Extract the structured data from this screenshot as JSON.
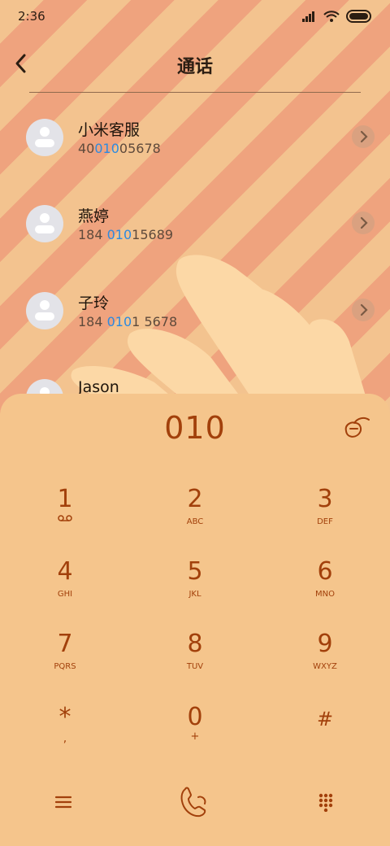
{
  "status_bar": {
    "time": "2:36"
  },
  "header": {
    "title": "通话"
  },
  "contacts": [
    {
      "name": "小米客服",
      "number_pre": "40",
      "number_hl": "010",
      "number_post": "05678"
    },
    {
      "name": "燕婷",
      "number_pre": "184 ",
      "number_hl": "010",
      "number_post": "15689"
    },
    {
      "name": "子玲",
      "number_pre": "184 ",
      "number_hl": "010",
      "number_post": "1 5678"
    },
    {
      "name": "Jason",
      "number_pre": "",
      "number_hl": "",
      "number_post": ""
    }
  ],
  "dialer": {
    "dialed": "010",
    "keys": [
      {
        "num": "1",
        "sub": ""
      },
      {
        "num": "2",
        "sub": "ABC"
      },
      {
        "num": "3",
        "sub": "DEF"
      },
      {
        "num": "4",
        "sub": "GHI"
      },
      {
        "num": "5",
        "sub": "JKL"
      },
      {
        "num": "6",
        "sub": "MNO"
      },
      {
        "num": "7",
        "sub": "PQRS"
      },
      {
        "num": "8",
        "sub": "TUV"
      },
      {
        "num": "9",
        "sub": "WXYZ"
      },
      {
        "num": "*",
        "sub": ","
      },
      {
        "num": "0",
        "sub": "+"
      },
      {
        "num": "#",
        "sub": ""
      }
    ]
  },
  "icons": {
    "back": "chevron-left-icon",
    "chevron": "chevron-right-icon",
    "backspace": "backspace-icon",
    "menu": "menu-icon",
    "call": "phone-call-icon",
    "keypad": "keypad-icon",
    "voicemail": "voicemail-icon"
  },
  "colors": {
    "accent": "#a2400b",
    "highlight": "#2c8ae0",
    "panel": "#f5c58c"
  }
}
